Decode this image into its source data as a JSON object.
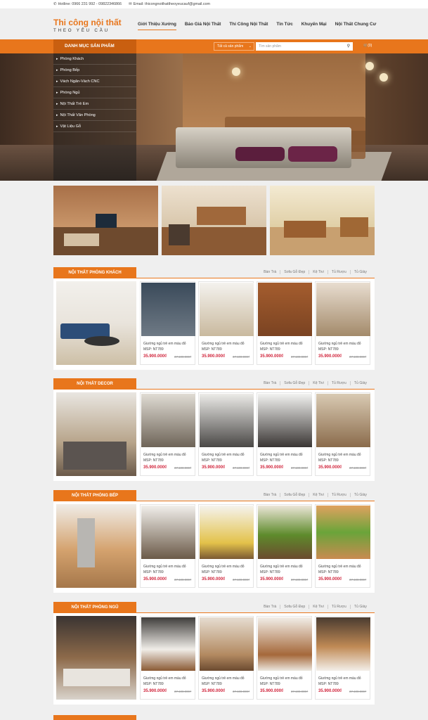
{
  "topbar": {
    "hotline": "Hotline: 0966 231 992 - 09822346866",
    "email": "Email: thicongnoithattheoyeucauf@gmail.com"
  },
  "logo": {
    "line1": "Thi công nội thất",
    "line2": "THEO YÊU CẦU"
  },
  "nav": [
    "Giới Thiệu Xưởng",
    "Báo Giá Nội Thất",
    "Thi Công Nội Thất",
    "Tin Tức",
    "Khuyến Mại",
    "Nội Thất Chung Cư"
  ],
  "catbar": {
    "title": "DANH MỤC SẢN PHẨM",
    "select": "Tất cả sản phẩm",
    "search_placeholder": "Tìm sản phẩm",
    "cart": "(0)"
  },
  "categories": [
    "Phòng Khách",
    "Phòng Bếp",
    "Vách Ngăn-Vách CNC",
    "Phòng Ngủ",
    "Nội Thất Trẻ Em",
    "Nội Thất Văn Phòng",
    "Vật Liệu Gỗ"
  ],
  "section_links": [
    "Bàn Trà",
    "Sofa Gỗ Đẹp",
    "Kệ Tivi",
    "Tủ Rượu",
    "Tủ Giày"
  ],
  "sections": [
    {
      "title": "NỘI THẤT PHÒNG KHÁCH"
    },
    {
      "title": "NỘI THẤT DECOR"
    },
    {
      "title": "NỘI THẤT PHÒNG BẾP"
    },
    {
      "title": "NỘI THẤT PHÒNG NGỦ"
    }
  ],
  "product": {
    "name": "Giường ngủ trẻ em màu đỏ",
    "sku": "MSP: NT789",
    "price": "35.900.000₫",
    "old_price": "37.100.000₫"
  },
  "colors": {
    "accent": "#e8761c",
    "accent_dark": "#c95f10",
    "price": "#d0233a"
  },
  "icons": {
    "phone": "phone-icon",
    "mail": "mail-icon",
    "search": "search-icon",
    "cart": "cart-icon",
    "bullet": "chevron-right-icon"
  }
}
